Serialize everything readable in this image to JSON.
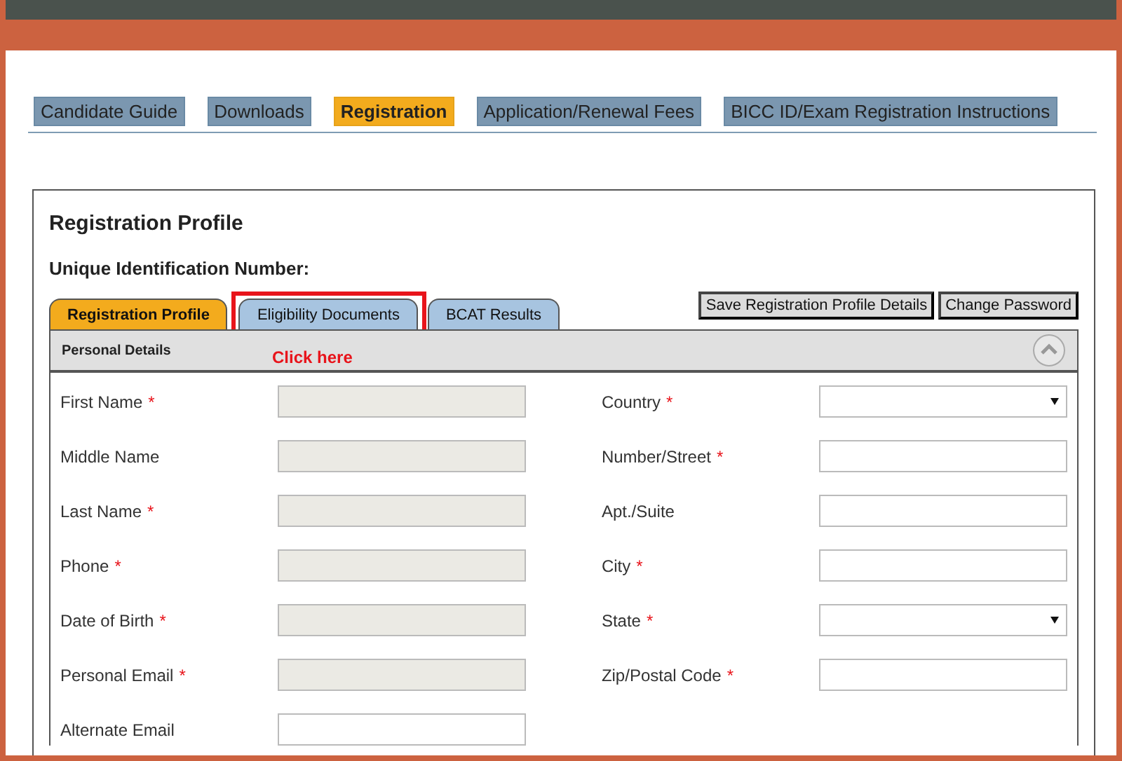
{
  "nav": [
    {
      "label": "Candidate Guide",
      "selected": false
    },
    {
      "label": "Downloads",
      "selected": false
    },
    {
      "label": "Registration",
      "selected": true
    },
    {
      "label": "Application/Renewal Fees",
      "selected": false
    },
    {
      "label": "BICC ID/Exam Registration Instructions",
      "selected": false
    }
  ],
  "profile": {
    "title": "Registration Profile",
    "uid_label": "Unique Identification Number:",
    "tabs": [
      {
        "label": "Registration Profile",
        "selected": true,
        "highlighted": false
      },
      {
        "label": "Eligibility Documents",
        "selected": false,
        "highlighted": true
      },
      {
        "label": "BCAT Results",
        "selected": false,
        "highlighted": false
      }
    ],
    "callout": "Click here",
    "buttons": [
      "Save Registration Profile Details",
      "Change Password"
    ],
    "section": {
      "title": "Personal Details",
      "expanded": true
    },
    "left_fields": [
      {
        "label": "First Name",
        "required_mark": "*",
        "disabled": true
      },
      {
        "label": "Middle Name",
        "disabled": true
      },
      {
        "label": "Last Name",
        "required_mark": "*",
        "disabled": true
      },
      {
        "label": "Phone",
        "required_mark": "*",
        "disabled": true
      },
      {
        "label": "Date of Birth",
        "required_mark": "*",
        "disabled": true
      },
      {
        "label": "Personal Email",
        "required_mark": "*",
        "disabled": true
      },
      {
        "label": "Alternate Email",
        "disabled": false
      }
    ],
    "right_fields": [
      {
        "label": "Country",
        "required_mark": "*",
        "kind": "select"
      },
      {
        "label": "Number/Street",
        "required_mark": "*",
        "kind": "text"
      },
      {
        "label": "Apt./Suite",
        "kind": "text"
      },
      {
        "label": "City",
        "required_mark": "*",
        "kind": "text"
      },
      {
        "label": "State",
        "required_mark": "*",
        "kind": "select"
      },
      {
        "label": "Zip/Postal Code",
        "required_mark": "*",
        "kind": "text"
      }
    ]
  }
}
